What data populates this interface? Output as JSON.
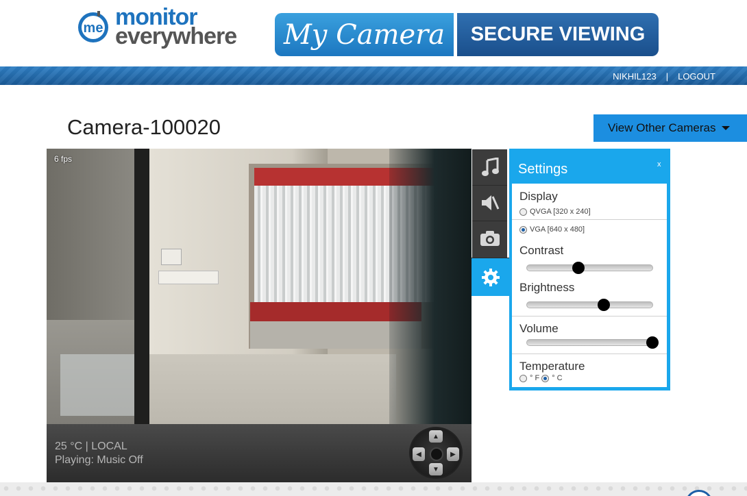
{
  "header": {
    "logo_line1": "monitor",
    "logo_line2": "everywhere",
    "logo_badge": "me",
    "banner_left": "My Camera",
    "banner_right": "SECURE VIEWING"
  },
  "user_bar": {
    "username": "NIKHIL123",
    "separator": "|",
    "logout": "LOGOUT"
  },
  "camera": {
    "title": "Camera-100020",
    "view_other_label": "View Other Cameras",
    "fps": "6 fps",
    "status_line1": "25 °C | LOCAL",
    "status_line2": "Playing: Music Off"
  },
  "toolbar": {
    "items": [
      {
        "icon": "music-note-icon",
        "active": false
      },
      {
        "icon": "speaker-mute-icon",
        "active": false
      },
      {
        "icon": "camera-icon",
        "active": false
      },
      {
        "icon": "gear-icon",
        "active": true
      }
    ]
  },
  "settings": {
    "title": "Settings",
    "close": "x",
    "display_label": "Display",
    "display_options": [
      {
        "label": "QVGA [320 x 240]",
        "selected": false
      },
      {
        "label": "VGA [640 x 480]",
        "selected": true
      }
    ],
    "contrast_label": "Contrast",
    "contrast_value": 0.41,
    "brightness_label": "Brightness",
    "brightness_value": 0.61,
    "volume_label": "Volume",
    "volume_value": 1.0,
    "temperature_label": "Temperature",
    "temperature_options": [
      {
        "label": "° F",
        "selected": false
      },
      {
        "label": "° C",
        "selected": true
      }
    ]
  },
  "colors": {
    "accent": "#1aa7ec",
    "brand_blue": "#1e73be",
    "bar_blue": "#1c77c0"
  }
}
